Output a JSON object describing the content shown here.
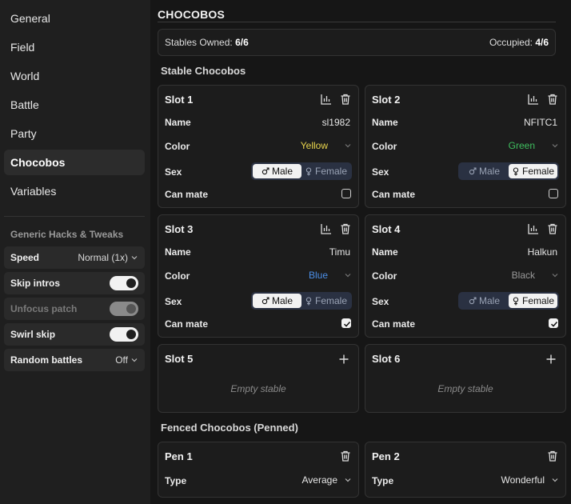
{
  "sidebar": {
    "nav": [
      {
        "label": "General"
      },
      {
        "label": "Field"
      },
      {
        "label": "World"
      },
      {
        "label": "Battle"
      },
      {
        "label": "Party"
      },
      {
        "label": "Chocobos"
      },
      {
        "label": "Variables"
      }
    ],
    "active_nav": "Chocobos",
    "hacks_heading": "Generic Hacks & Tweaks",
    "tweaks": [
      {
        "label": "Speed",
        "value": "Normal (1x)"
      },
      {
        "label": "Skip intros",
        "toggle": true
      },
      {
        "label": "Unfocus patch",
        "toggle": true,
        "disabled": true
      },
      {
        "label": "Swirl skip",
        "toggle": true
      },
      {
        "label": "Random battles",
        "value": "Off"
      }
    ]
  },
  "main": {
    "title": "CHOCOBOS",
    "summary": {
      "stables_label": "Stables Owned:",
      "stables_value": "6/6",
      "occupied_label": "Occupied:",
      "occupied_value": "4/6"
    },
    "stable_section": "Stable Chocobos",
    "fields": {
      "name": "Name",
      "color": "Color",
      "sex": "Sex",
      "can_mate": "Can mate",
      "type": "Type",
      "male": "Male",
      "female": "Female"
    },
    "slots": [
      {
        "title": "Slot 1",
        "name": "sl1982",
        "color": "Yellow",
        "color_hex": "#e8d44d",
        "sex": "male",
        "can_mate": false
      },
      {
        "title": "Slot 2",
        "name": "NFITC1",
        "color": "Green",
        "color_hex": "#3fbf5f",
        "sex": "female",
        "can_mate": false
      },
      {
        "title": "Slot 3",
        "name": "Timu",
        "color": "Blue",
        "color_hex": "#4b8fe8",
        "sex": "male",
        "can_mate": true
      },
      {
        "title": "Slot 4",
        "name": "Halkun",
        "color": "Black",
        "color_hex": "#9a9a9a",
        "sex": "female",
        "can_mate": true
      },
      {
        "title": "Slot 5",
        "empty": "Empty stable"
      },
      {
        "title": "Slot 6",
        "empty": "Empty stable"
      }
    ],
    "pen_section": "Fenced Chocobos (Penned)",
    "pens": [
      {
        "title": "Pen 1",
        "type": "Average"
      },
      {
        "title": "Pen 2",
        "type": "Wonderful"
      }
    ]
  },
  "icons": {
    "stats": "bar-chart-icon",
    "delete": "trash-icon",
    "add": "plus-icon",
    "chevron": "chevron-down-icon"
  }
}
